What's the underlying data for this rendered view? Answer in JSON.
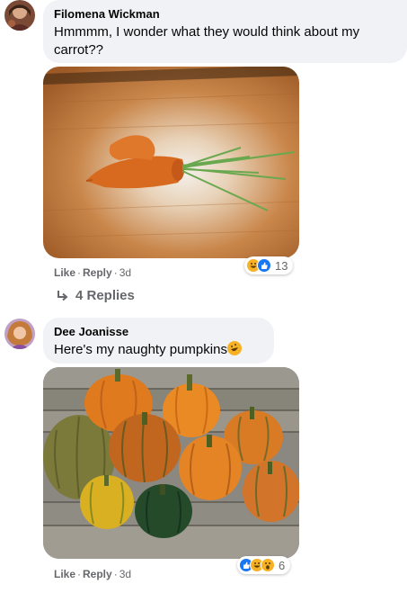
{
  "comments": [
    {
      "author": "Filomena Wickman",
      "text": "Hmmmm, I wonder what they would think about my carrot??",
      "actions": {
        "like": "Like",
        "reply": "Reply",
        "time": "3d"
      },
      "reactions": {
        "count": "13",
        "icons": [
          "haha-icon",
          "like-icon"
        ]
      },
      "replies_label": "4 Replies"
    },
    {
      "author": "Dee Joanisse",
      "text": "Here's my naughty pumpkins",
      "actions": {
        "like": "Like",
        "reply": "Reply",
        "time": "3d"
      },
      "reactions": {
        "count": "6",
        "icons": [
          "like-icon",
          "haha-icon",
          "wow-icon"
        ]
      }
    }
  ],
  "colors": {
    "bubble": "#f0f2f5",
    "muted": "#65676b",
    "like_blue": "#1877f2",
    "haha_yellow": "#f7b125"
  }
}
